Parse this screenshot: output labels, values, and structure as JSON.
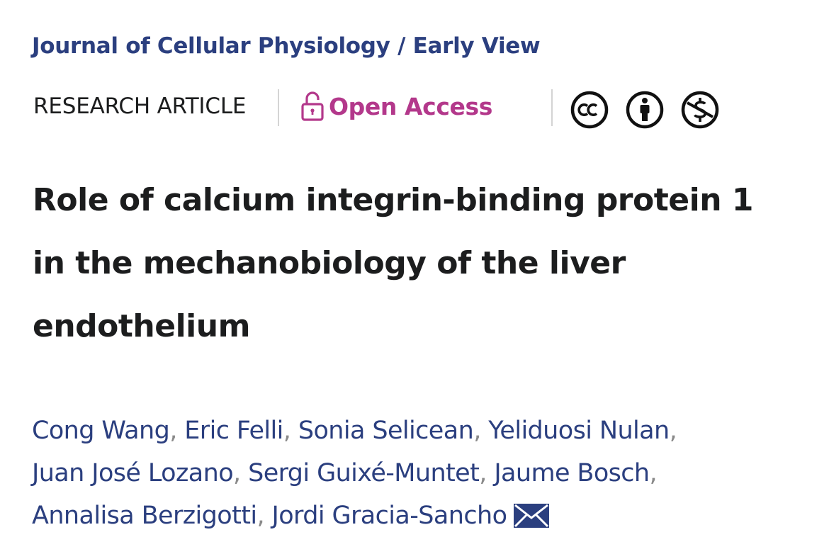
{
  "journal": {
    "name": "Journal of Cellular Physiology",
    "separator": "/",
    "section": "Early View",
    "full": "Journal of Cellular Physiology / Early View"
  },
  "article_meta": {
    "type": "RESEARCH ARTICLE",
    "access": {
      "label": "Open Access",
      "icon": "open-lock-icon"
    },
    "license_icons": [
      "creative-commons-icon",
      "attribution-icon",
      "non-commercial-icon"
    ]
  },
  "title": {
    "line1": "Role of calcium integrin-binding protein 1",
    "line2": "in the mechanobiology of the liver",
    "line3": "endothelium"
  },
  "authors": [
    "Cong Wang",
    "Eric Felli",
    "Sonia Selicean",
    "Yeliduosi Nulan",
    "Juan José Lozano",
    "Sergi Guixé-Muntet",
    "Jaume Bosch",
    "Annalisa Berzigotti",
    "Jordi Gracia-Sancho"
  ],
  "author_separator": ",",
  "corresponding_icon": "envelope-icon",
  "colors": {
    "journal_blue": "#2b3f7f",
    "open_access_magenta": "#b3388b",
    "text": "#1c1d1e"
  }
}
